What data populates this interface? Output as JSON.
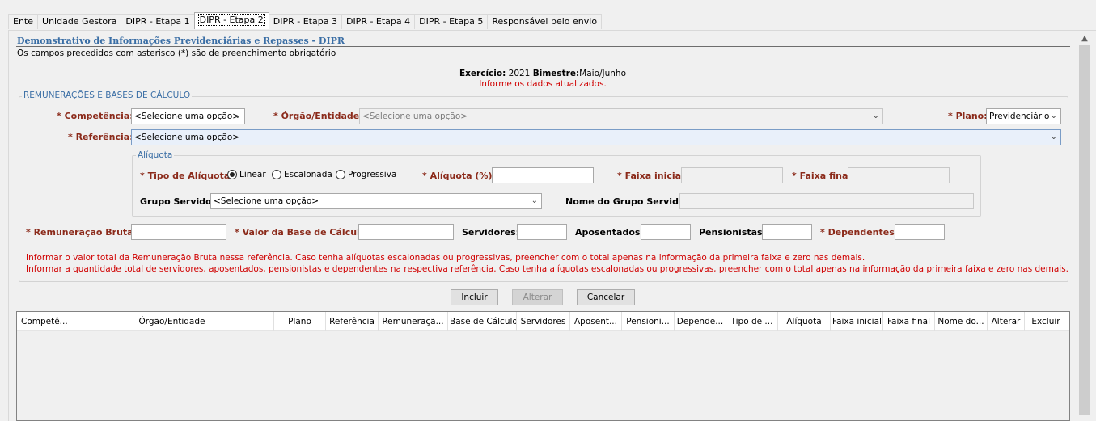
{
  "tabs": [
    "Ente",
    "Unidade Gestora",
    "DIPR - Etapa 1",
    "DIPR - Etapa 2",
    "DIPR - Etapa 3",
    "DIPR - Etapa 4",
    "DIPR - Etapa 5",
    "Responsável pelo envio"
  ],
  "active_tab": "DIPR - Etapa 2",
  "header": {
    "title": "Demonstrativo de Informações Previdenciárias e Repasses - DIPR",
    "subtitle": "Os campos precedidos com asterisco (*) são de preenchimento obrigatório"
  },
  "exercise": {
    "exercicio_label": "Exercício:",
    "exercicio_value": "2021",
    "bimestre_label": "Bimestre:",
    "bimestre_value": "Maio/Junho",
    "warning": "Informe os dados atualizados."
  },
  "section": {
    "legend": "REMUNERAÇÕES E BASES DE CÁLCULO",
    "competencia_label": "* Competência:",
    "competencia_value": "<Selecione uma opção>",
    "orgao_label": "* Órgão/Entidade:",
    "orgao_value": "<Selecione uma opção>",
    "plano_label": "* Plano:",
    "plano_value": "Previdenciário",
    "referencia_label": "* Referência:",
    "referencia_value": "<Selecione uma opção>"
  },
  "aliquota": {
    "legend": "Alíquota",
    "tipo_label": "* Tipo de Alíquota:",
    "options": [
      "Linear",
      "Escalonada",
      "Progressiva"
    ],
    "selected": "Linear",
    "aliquota_label": "* Alíquota (%):",
    "aliquota_value": "",
    "faixa_inicial_label": "* Faixa inicial:",
    "faixa_final_label": "* Faixa final:",
    "grupo_label": "Grupo Servidor:",
    "grupo_value": "<Selecione uma opção>",
    "nome_grupo_label": "Nome do Grupo Servidor:"
  },
  "values_row": {
    "remuneracao_label": "* Remuneração Bruta:",
    "base_label": "* Valor da Base de Cálculo:",
    "servidores_label": "Servidores:",
    "aposentados_label": "Aposentados:",
    "pensionistas_label": "Pensionistas:",
    "dependentes_label": "* Dependentes:"
  },
  "notes": [
    "Informar o valor total da Remuneração Bruta nessa referência. Caso tenha alíquotas escalonadas ou progressivas, preencher com o total apenas na informação da primeira faixa e zero nas demais.",
    "Informar a quantidade total de servidores, aposentados, pensionistas e dependentes na respectiva referência. Caso tenha alíquotas escalonadas ou progressivas, preencher com o total apenas na informação da primeira faixa e zero nas demais."
  ],
  "buttons": {
    "incluir": "Incluir",
    "alterar": "Alterar",
    "cancelar": "Cancelar"
  },
  "table": {
    "columns": [
      "Competê...",
      "Órgão/Entidade",
      "Plano",
      "Referência",
      "Remuneraçã...",
      "Base de Cálculo",
      "Servidores",
      "Aposent...",
      "Pensioni...",
      "Depende...",
      "Tipo de ...",
      "Alíquota",
      "Faixa inicial",
      "Faixa final",
      "Nome do...",
      "Alterar",
      "Excluir"
    ]
  },
  "icons": {
    "dropdown": "chevron-down-icon",
    "scroll_up": "scroll-up-icon"
  },
  "colors": {
    "title_blue": "#3a6ea5",
    "label_red": "#8b2a1a",
    "warning_red": "#d00000"
  }
}
